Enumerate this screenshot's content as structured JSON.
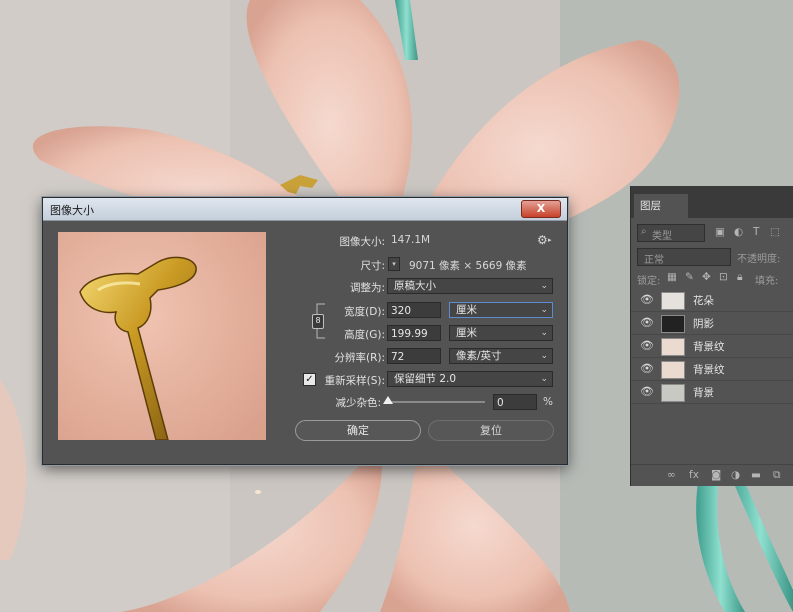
{
  "dialog": {
    "title": "图像大小",
    "close_label": "X",
    "image_size_label": "图像大小:",
    "image_size_value": "147.1M",
    "dimensions_label": "尺寸:",
    "dimensions_value": "9071 像素 × 5669 像素",
    "fit_to_label": "调整为:",
    "fit_to_value": "原稿大小",
    "width_label": "宽度(D):",
    "width_value": "320",
    "width_unit": "厘米",
    "height_label": "高度(G):",
    "height_value": "199.99",
    "height_unit": "厘米",
    "resolution_label": "分辨率(R):",
    "resolution_value": "72",
    "resolution_unit": "像素/英寸",
    "resample_label": "重新采样(S):",
    "resample_checked": true,
    "resample_value": "保留细节 2.0",
    "noise_label": "减少杂色:",
    "noise_value": "0",
    "noise_unit": "%",
    "noise_level": 0,
    "ok_label": "确定",
    "reset_label": "复位"
  },
  "layers_panel": {
    "tab_label": "图层",
    "filter_label": "类型",
    "blend_mode": "正常",
    "opacity_label": "不透明度:",
    "lock_label": "锁定:",
    "fill_label": "填充:",
    "layers": [
      {
        "name": "花朵"
      },
      {
        "name": "阴影"
      },
      {
        "name": "背景纹"
      },
      {
        "name": "背景纹"
      },
      {
        "name": "背景"
      }
    ]
  },
  "colors": {
    "dialog_bg": "#535353",
    "accent": "#5b8bd0",
    "petal": "#ecc0b0",
    "stem": "#5fbfae"
  },
  "icons": [
    "gear-icon",
    "link-chain-icon",
    "eye-icon",
    "checkbox-icon",
    "chevron-down-icon",
    "close-icon"
  ]
}
